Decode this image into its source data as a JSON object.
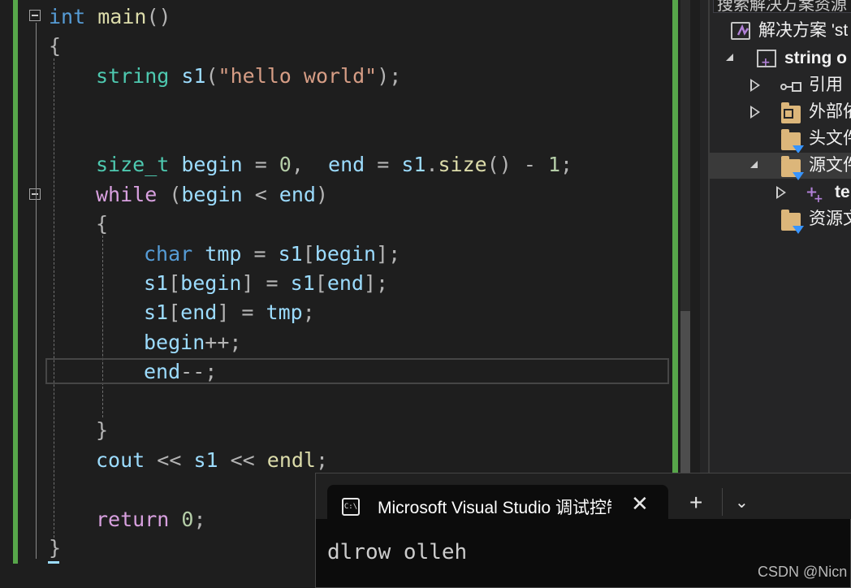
{
  "editor": {
    "lines": [
      {
        "tokens": [
          {
            "t": "int",
            "c": "kw"
          },
          {
            "t": " "
          },
          {
            "t": "main",
            "c": "fn"
          },
          {
            "t": "()",
            "c": "op"
          }
        ]
      },
      {
        "tokens": [
          {
            "t": "{",
            "c": "op"
          }
        ]
      },
      {
        "tokens": [
          {
            "t": "string",
            "c": "type"
          },
          {
            "t": " "
          },
          {
            "t": "s1",
            "c": "var"
          },
          {
            "t": "(",
            "c": "op"
          },
          {
            "t": "\"hello world\"",
            "c": "str"
          },
          {
            "t": ");",
            "c": "op"
          }
        ]
      },
      {
        "tokens": [
          {
            "t": "size_t",
            "c": "type"
          },
          {
            "t": " "
          },
          {
            "t": "begin",
            "c": "var"
          },
          {
            "t": " = ",
            "c": "op"
          },
          {
            "t": "0",
            "c": "num"
          },
          {
            "t": ",  ",
            "c": "op"
          },
          {
            "t": "end",
            "c": "var"
          },
          {
            "t": " = ",
            "c": "op"
          },
          {
            "t": "s1",
            "c": "var"
          },
          {
            "t": ".",
            "c": "op"
          },
          {
            "t": "size",
            "c": "fn"
          },
          {
            "t": "() - ",
            "c": "op"
          },
          {
            "t": "1",
            "c": "num"
          },
          {
            "t": ";",
            "c": "op"
          }
        ]
      },
      {
        "tokens": [
          {
            "t": "while",
            "c": "kw2"
          },
          {
            "t": " (",
            "c": "op"
          },
          {
            "t": "begin",
            "c": "var"
          },
          {
            "t": " < ",
            "c": "op"
          },
          {
            "t": "end",
            "c": "var"
          },
          {
            "t": ")",
            "c": "op"
          }
        ]
      },
      {
        "tokens": [
          {
            "t": "{",
            "c": "op"
          }
        ]
      },
      {
        "tokens": [
          {
            "t": "char",
            "c": "kw"
          },
          {
            "t": " "
          },
          {
            "t": "tmp",
            "c": "var"
          },
          {
            "t": " = ",
            "c": "op"
          },
          {
            "t": "s1",
            "c": "var"
          },
          {
            "t": "[",
            "c": "op"
          },
          {
            "t": "begin",
            "c": "var"
          },
          {
            "t": "];",
            "c": "op"
          }
        ]
      },
      {
        "tokens": [
          {
            "t": "s1",
            "c": "var"
          },
          {
            "t": "[",
            "c": "op"
          },
          {
            "t": "begin",
            "c": "var"
          },
          {
            "t": "] = ",
            "c": "op"
          },
          {
            "t": "s1",
            "c": "var"
          },
          {
            "t": "[",
            "c": "op"
          },
          {
            "t": "end",
            "c": "var"
          },
          {
            "t": "];",
            "c": "op"
          }
        ]
      },
      {
        "tokens": [
          {
            "t": "s1",
            "c": "var"
          },
          {
            "t": "[",
            "c": "op"
          },
          {
            "t": "end",
            "c": "var"
          },
          {
            "t": "] = ",
            "c": "op"
          },
          {
            "t": "tmp",
            "c": "var"
          },
          {
            "t": ";",
            "c": "op"
          }
        ]
      },
      {
        "tokens": [
          {
            "t": "begin",
            "c": "var"
          },
          {
            "t": "++;",
            "c": "op"
          }
        ]
      },
      {
        "tokens": [
          {
            "t": "end",
            "c": "var"
          },
          {
            "t": "--;",
            "c": "op"
          }
        ]
      },
      {
        "tokens": [
          {
            "t": "}",
            "c": "op"
          }
        ]
      },
      {
        "tokens": [
          {
            "t": "cout",
            "c": "var"
          },
          {
            "t": " << ",
            "c": "op"
          },
          {
            "t": "s1",
            "c": "var"
          },
          {
            "t": " << ",
            "c": "op"
          },
          {
            "t": "endl",
            "c": "fn"
          },
          {
            "t": ";",
            "c": "op"
          }
        ]
      },
      {
        "tokens": [
          {
            "t": "return",
            "c": "kw2"
          },
          {
            "t": " "
          },
          {
            "t": "0",
            "c": "num"
          },
          {
            "t": ";",
            "c": "op"
          }
        ]
      },
      {
        "tokens": [
          {
            "t": "}",
            "c": "op"
          }
        ]
      }
    ]
  },
  "solution_explorer": {
    "search_placeholder": "搜索解决方案资源",
    "items": [
      {
        "label": "解决方案 'st",
        "icon": "solution-icon"
      },
      {
        "label": "string o",
        "icon": "cpp-project-icon"
      },
      {
        "label": "引用",
        "icon": "references-icon"
      },
      {
        "label": "外部依",
        "icon": "external-deps-icon"
      },
      {
        "label": "头文件",
        "icon": "filter-folder-icon"
      },
      {
        "label": "源文件",
        "icon": "filter-folder-icon"
      },
      {
        "label": "te",
        "icon": "cpp-file-icon"
      },
      {
        "label": "资源文",
        "icon": "filter-folder-icon"
      }
    ]
  },
  "terminal": {
    "tab_title": "Microsoft Visual Studio 调试控制台",
    "tab_icon_text": "C:\\",
    "close_label": "✕",
    "new_tab_label": "+",
    "dropdown_label": "⌄",
    "output": "dlrow olleh"
  },
  "watermark": "CSDN @Nicn"
}
